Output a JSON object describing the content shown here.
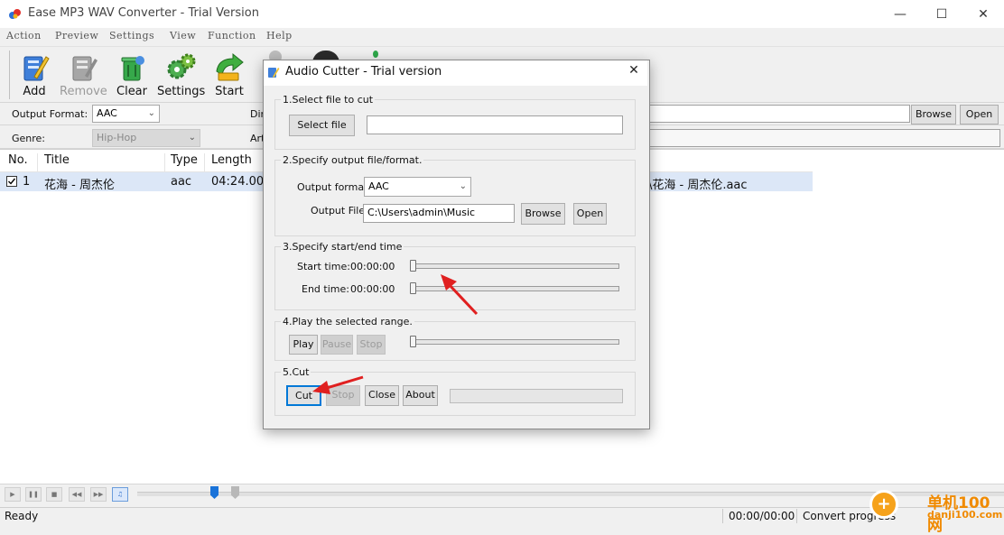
{
  "window": {
    "title": "Ease MP3 WAV Converter - Trial Version",
    "minimize": "—",
    "maximize": "☐",
    "close": "✕"
  },
  "menu": [
    "Action",
    "Preview",
    "Settings",
    "View",
    "Function",
    "Help"
  ],
  "toolbar": {
    "add": "Add",
    "remove": "Remove",
    "clear": "Clear",
    "settings": "Settings",
    "start": "Start"
  },
  "settings": {
    "output_format_label": "Output Format:",
    "output_format_value": "AAC",
    "genre_label": "Genre:",
    "genre_value": "Hip-Hop",
    "dir_label": "Dir",
    "art_label": "Art",
    "browse": "Browse",
    "open": "Open"
  },
  "list": {
    "headers": [
      "No.",
      "Title",
      "Type",
      "Length"
    ],
    "rows": [
      {
        "no": "1",
        "title": "花海 - 周杰伦",
        "type": "aac",
        "length": "04:24.00",
        "output": "\\花海 - 周杰伦.aac"
      }
    ]
  },
  "status": {
    "ready": "Ready",
    "time": "00:00/00:00",
    "convert": "Convert progress"
  },
  "watermark": {
    "site": "单机100网",
    "url": "danji100.com"
  },
  "dialog": {
    "title": "Audio Cutter - Trial version",
    "close": "✕",
    "section1": {
      "title": "1.Select file to cut",
      "select_button": "Select file",
      "file_value": ""
    },
    "section2": {
      "title": "2.Specify output file/format.",
      "format_label": "Output format:",
      "format_value": "AAC",
      "file_label": "Output File:",
      "file_value": "C:\\Users\\admin\\Music",
      "browse": "Browse",
      "open": "Open"
    },
    "section3": {
      "title": "3.Specify start/end time",
      "start_label": "Start time:",
      "start_value": "00:00:00",
      "end_label": "End time:",
      "end_value": "00:00:00"
    },
    "section4": {
      "title": "4.Play the selected range.",
      "play": "Play",
      "pause": "Pause",
      "stop": "Stop"
    },
    "section5": {
      "title": "5.Cut",
      "cut": "Cut",
      "stop": "Stop",
      "close": "Close",
      "about": "About"
    }
  },
  "colors": {
    "accent": "#0078d7",
    "selection": "#dce7f7",
    "annotation_arrow": "#e02020"
  }
}
